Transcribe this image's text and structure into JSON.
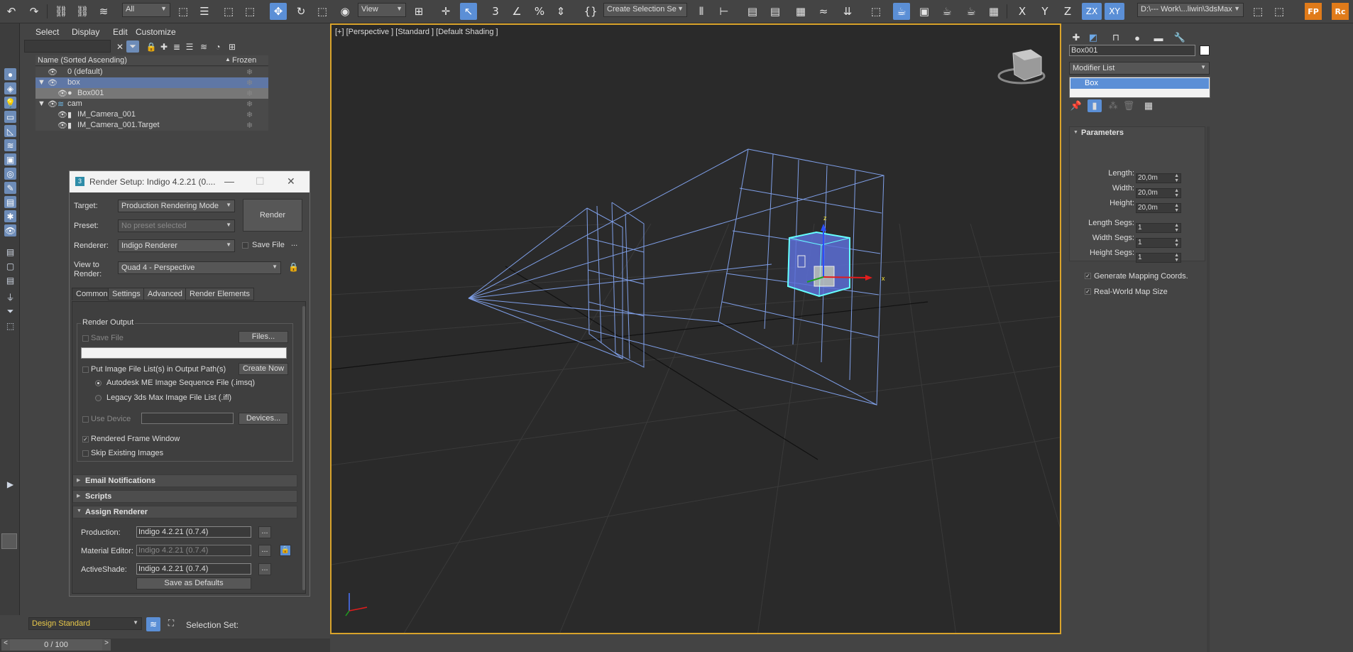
{
  "toolbar": {
    "selection_filter": "All",
    "reference_coord": "View",
    "named_selection": "Create Selection Se",
    "project_path": "D:\\--- Work\\...liwin\\3dsMax",
    "axis_x": "X",
    "axis_y": "Y",
    "axis_z": "Z",
    "axis_zx": "ZX",
    "axis_xy": "XY",
    "fp_label": "FP",
    "rc_label": "Rc"
  },
  "explorer": {
    "menu": [
      "Select",
      "Display",
      "Edit",
      "Customize"
    ],
    "column_name": "Name (Sorted Ascending)",
    "column_frozen": "Frozen",
    "rows": [
      {
        "label": "0 (default)"
      },
      {
        "label": "box"
      },
      {
        "label": "Box001"
      },
      {
        "label": "cam"
      },
      {
        "label": "IM_Camera_001"
      },
      {
        "label": "IM_Camera_001.Target"
      }
    ]
  },
  "render_setup": {
    "title": "Render Setup: Indigo 4.2.21 (0....",
    "target_label": "Target:",
    "target_value": "Production Rendering Mode",
    "preset_label": "Preset:",
    "preset_value": "No preset selected",
    "renderer_label": "Renderer:",
    "renderer_value": "Indigo Renderer",
    "save_file_label": "Save File",
    "view_label_1": "View to",
    "view_label_2": "Render:",
    "view_value": "Quad 4 - Perspective",
    "render_button": "Render",
    "more_button": "...",
    "tabs": [
      "Common",
      "Settings",
      "Advanced",
      "Render Elements"
    ],
    "render_output_title": "Render Output",
    "ro_save_file": "Save File",
    "ro_files_button": "Files...",
    "ro_put_image": "Put Image File List(s) in Output Path(s)",
    "ro_create_now": "Create Now",
    "ro_radio_1": "Autodesk ME Image Sequence File (.imsq)",
    "ro_radio_2": "Legacy 3ds Max Image File List (.ifl)",
    "ro_use_device": "Use Device",
    "ro_devices_button": "Devices...",
    "ro_rendered_frame": "Rendered Frame Window",
    "ro_skip_existing": "Skip Existing Images",
    "rollout_email": "Email Notifications",
    "rollout_scripts": "Scripts",
    "rollout_assign": "Assign Renderer",
    "assign_production_label": "Production:",
    "assign_production_value": "Indigo 4.2.21 (0.7.4)",
    "assign_material_label": "Material Editor:",
    "assign_material_value": "Indigo 4.2.21 (0.7.4)",
    "assign_activeshade_label": "ActiveShade:",
    "assign_activeshade_value": "Indigo 4.2.21 (0.7.4)",
    "save_defaults": "Save as Defaults"
  },
  "viewport": {
    "label": "[+] [Perspective ] [Standard ] [Default Shading ]",
    "gizmo_x": "x",
    "gizmo_z": "z"
  },
  "command_panel": {
    "object_name": "Box001",
    "modifier_list": "Modifier List",
    "stack_item": "Box",
    "parameters_title": "Parameters",
    "params": [
      {
        "label": "Length:",
        "value": "20,0m"
      },
      {
        "label": "Width:",
        "value": "20,0m"
      },
      {
        "label": "Height:",
        "value": "20,0m"
      },
      {
        "label": "Length Segs:",
        "value": "1"
      },
      {
        "label": "Width Segs:",
        "value": "1"
      },
      {
        "label": "Height Segs:",
        "value": "1"
      }
    ],
    "generate_mapping": "Generate Mapping Coords.",
    "real_world": "Real-World Map Size"
  },
  "status": {
    "workspace": "Design Standard",
    "selection_set": "Selection Set:",
    "time_slider": "0 / 100"
  },
  "colors": {
    "viewport_border": "#d9a32b",
    "selection_blue": "#5f77a5",
    "wireframe": "#7f9fe8"
  }
}
